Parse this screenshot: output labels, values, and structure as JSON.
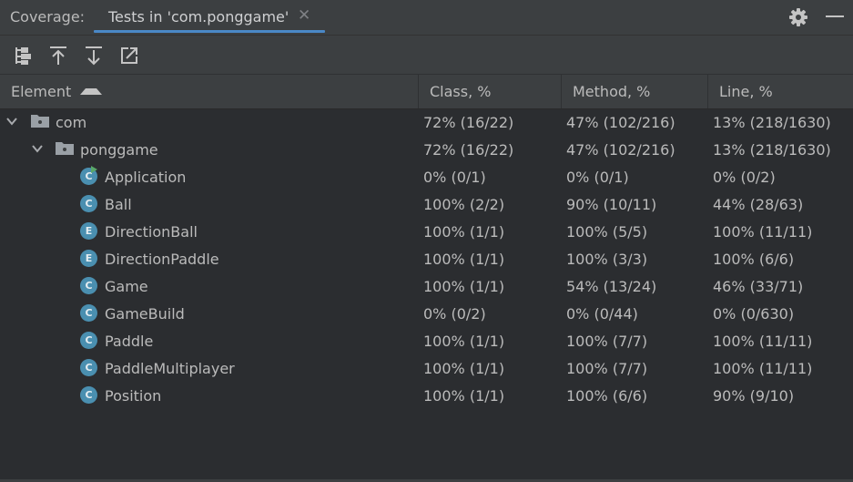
{
  "titlebar": {
    "label": "Coverage:",
    "tab_label": "Tests in 'com.ponggame'",
    "close_glyph": "✕",
    "settings_icon": "gear-icon",
    "minimize_icon": "minimize-icon"
  },
  "toolbar": {
    "buttons": [
      "flatten-packages-icon",
      "navigate-up-icon",
      "navigate-down-icon",
      "export-icon"
    ]
  },
  "table": {
    "columns": [
      "Element",
      "Class, %",
      "Method, %",
      "Line, %"
    ],
    "sort_column": "Element",
    "sort_direction": "ascending",
    "rows": [
      {
        "name": "com",
        "kind": "package",
        "depth": 0,
        "expanded": true,
        "class": "72% (16/22)",
        "method": "47% (102/216)",
        "line": "13% (218/1630)"
      },
      {
        "name": "ponggame",
        "kind": "package",
        "depth": 1,
        "expanded": true,
        "class": "72% (16/22)",
        "method": "47% (102/216)",
        "line": "13% (218/1630)"
      },
      {
        "name": "Application",
        "kind": "class",
        "badge": "C",
        "runnable": true,
        "depth": 2,
        "class": "0% (0/1)",
        "method": "0% (0/1)",
        "line": "0% (0/2)"
      },
      {
        "name": "Ball",
        "kind": "class",
        "badge": "C",
        "depth": 2,
        "class": "100% (2/2)",
        "method": "90% (10/11)",
        "line": "44% (28/63)"
      },
      {
        "name": "DirectionBall",
        "kind": "enum",
        "badge": "E",
        "depth": 2,
        "class": "100% (1/1)",
        "method": "100% (5/5)",
        "line": "100% (11/11)"
      },
      {
        "name": "DirectionPaddle",
        "kind": "enum",
        "badge": "E",
        "depth": 2,
        "class": "100% (1/1)",
        "method": "100% (3/3)",
        "line": "100% (6/6)"
      },
      {
        "name": "Game",
        "kind": "class",
        "badge": "C",
        "depth": 2,
        "class": "100% (1/1)",
        "method": "54% (13/24)",
        "line": "46% (33/71)"
      },
      {
        "name": "GameBuild",
        "kind": "class",
        "badge": "C",
        "depth": 2,
        "class": "0% (0/2)",
        "method": "0% (0/44)",
        "line": "0% (0/630)"
      },
      {
        "name": "Paddle",
        "kind": "class",
        "badge": "C",
        "depth": 2,
        "class": "100% (1/1)",
        "method": "100% (7/7)",
        "line": "100% (11/11)"
      },
      {
        "name": "PaddleMultiplayer",
        "kind": "class",
        "badge": "C",
        "depth": 2,
        "class": "100% (1/1)",
        "method": "100% (7/7)",
        "line": "100% (11/11)"
      },
      {
        "name": "Position",
        "kind": "class",
        "badge": "C",
        "depth": 2,
        "class": "100% (1/1)",
        "method": "100% (6/6)",
        "line": "90% (9/10)"
      }
    ]
  },
  "colors": {
    "background": "#2b2d30",
    "panel": "#3c3f41",
    "accent": "#4a88c7",
    "class_icon": "#4a8fb0",
    "run_badge": "#59a869"
  }
}
